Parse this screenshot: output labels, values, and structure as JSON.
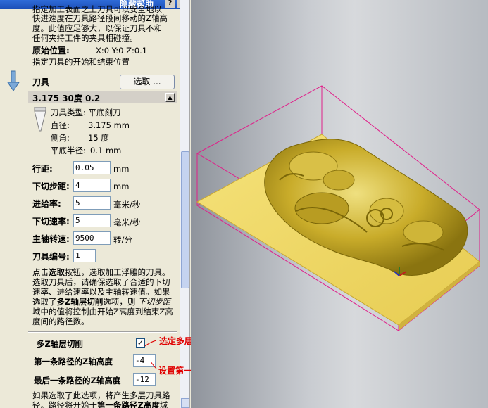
{
  "window": {
    "title": "隐藏帮助",
    "help_button": "?",
    "close_button": "X"
  },
  "intro": {
    "line0": "指定加工表面之上刀具可以安全地以",
    "line1": "快进速度在刀具路径段间移动的Z轴高",
    "line2": "度。此值应足够大，以保证刀具不和",
    "line3": "任何夹持工件的夹具相碰撞。"
  },
  "home": {
    "label": "原始位置:",
    "value": "X:0 Y:0 Z:0.1",
    "desc": "指定刀具的开始和结束位置"
  },
  "tool": {
    "section_label": "刀具",
    "select_button": "选取 ...",
    "name": "3.175 30度  0.2",
    "collapse_icon": "triangle-up",
    "type_line": "刀具类型: 平底刻刀",
    "diameter_label": "直径:",
    "diameter_value": "3.175 mm",
    "angle_label": "侧角:",
    "angle_value": "15 度",
    "flat_label": "平底半径:",
    "flat_value": "0.1 mm"
  },
  "params": {
    "stepover_label": "行距:",
    "stepover_value": "0.05",
    "stepover_unit": "mm",
    "stepdown_label": "下切步距:",
    "stepdown_value": "4",
    "stepdown_unit": "mm",
    "feed_label": "进给率:",
    "feed_value": "5",
    "feed_unit": "毫米/秒",
    "plunge_label": "下切速率:",
    "plunge_value": "5",
    "plunge_unit": "毫米/秒",
    "spindle_label": "主轴转速:",
    "spindle_value": "9500",
    "spindle_unit": "转/分",
    "toolno_label": "刀具编号:",
    "toolno_value": "1"
  },
  "help": {
    "line1a": "点击",
    "line1b": "选取",
    "line1c": "按钮，选取加工浮雕的刀具。",
    "line2": "选取刀具后，请确保选取了合适的下切",
    "line3": "速率、进给速率以及主轴转速值。如果",
    "line4a": "选取了",
    "line4b": "多Z轴层切削",
    "line4c": "选项，则",
    "line4d": "下切步距",
    "line5": "域中的值将控制由开始Z高度到结束Z高",
    "line6": "度间的路径数。"
  },
  "multiz": {
    "checkbox_label": "多Z轴层切削",
    "checked": true,
    "check_mark": "✓",
    "first_label": "第一条路径的Z轴高度",
    "first_value": "-4",
    "last_label": "最后一条路径的Z轴高度",
    "last_value": "-12",
    "foot1": "如果选取了此选项，将产生多层刀具路",
    "foot2a": "径。路径将开始于",
    "foot2b": "第一条路径Z高度",
    "foot2c": "域"
  },
  "annotations": {
    "multi_layer": "选定多层",
    "set_layers": "设置第一层和最后一层",
    "color": "#e00000"
  },
  "colors": {
    "titlebar": "#1c4fb7",
    "block_yellow": "#f2dc6a",
    "box_magenta": "#e0208a"
  }
}
